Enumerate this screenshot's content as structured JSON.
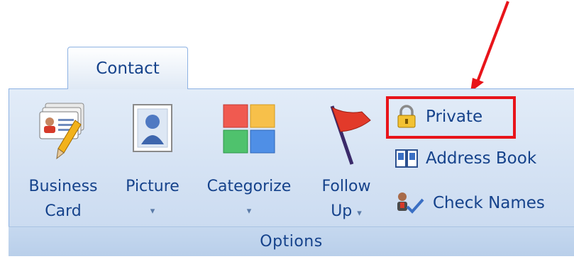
{
  "tab": {
    "label": "Contact"
  },
  "group": {
    "label": "Options"
  },
  "buttons": {
    "business_card": {
      "line1": "Business",
      "line2": "Card",
      "icon": "business-card-icon"
    },
    "picture": {
      "line1": "Picture",
      "arrow": "▾",
      "icon": "picture-icon"
    },
    "categorize": {
      "line1": "Categorize",
      "arrow": "▾",
      "icon": "categorize-icon"
    },
    "follow_up": {
      "line1": "Follow",
      "line2": "Up",
      "arrow": "▾",
      "icon": "flag-icon"
    }
  },
  "small_buttons": {
    "private": {
      "label": "Private",
      "icon": "lock-icon"
    },
    "address_book": {
      "label": "Address Book",
      "icon": "address-book-icon"
    },
    "check_names": {
      "label": "Check Names",
      "icon": "check-names-icon"
    }
  },
  "annotation": {
    "highlight_color": "#e8141a",
    "arrow_color": "#e8141a"
  }
}
